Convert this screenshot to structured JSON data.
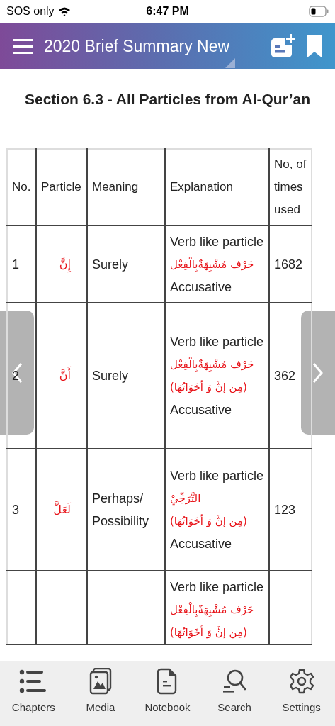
{
  "status_bar": {
    "carrier": "SOS only",
    "time": "6:47 PM"
  },
  "header": {
    "title": "2020 Brief Summary New"
  },
  "section_title": "Section 6.3 - All Particles from Al-Qur’an",
  "table": {
    "columns": [
      "No.",
      "Particle",
      "Meaning",
      "Explanation",
      "No, of times used"
    ],
    "rows": [
      {
        "no": "1",
        "particle": "إِنَّ",
        "meaning": "Surely",
        "explanation": [
          {
            "kind": "text",
            "text": "Verb like particle"
          },
          {
            "kind": "arabic",
            "text": "حَرْف مُشْبِهَةٌبِالْفِعْل"
          },
          {
            "kind": "text",
            "text": "Accusative"
          }
        ],
        "count": "1682"
      },
      {
        "no": "2",
        "particle": "أَنَّ",
        "meaning": "Surely",
        "explanation": [
          {
            "kind": "text",
            "text": "Verb like particle"
          },
          {
            "kind": "arabic",
            "text": "حَرْف مُشْبِهَةٌبِالْفِعْل"
          },
          {
            "kind": "arabic",
            "text": "(مِن إنَّ وَ أخَوَاتُهَا)"
          },
          {
            "kind": "text",
            "text": "Accusative"
          }
        ],
        "count": "362"
      },
      {
        "no": "3",
        "particle": "لَعَلَّ",
        "meaning": "Perhaps/ Possibility",
        "explanation": [
          {
            "kind": "text",
            "text": "Verb like particle"
          },
          {
            "kind": "arabic",
            "text": "التَّرَجِّيْ"
          },
          {
            "kind": "arabic",
            "text": "(مِن إنَّ وَ أخَوَاتُهَا)"
          },
          {
            "kind": "text",
            "text": "Accusative"
          }
        ],
        "count": "123"
      },
      {
        "explanation": [
          {
            "kind": "text",
            "text": "Verb like particle"
          },
          {
            "kind": "arabic",
            "text": "حَرْف مُشْبِهَةٌبِالْفِعْل"
          },
          {
            "kind": "arabic",
            "text": "(مِن إنَّ وَ أخَوَاتُهَا)"
          }
        ]
      }
    ]
  },
  "tabs": [
    {
      "label": "Chapters"
    },
    {
      "label": "Media"
    },
    {
      "label": "Notebook"
    },
    {
      "label": "Search"
    },
    {
      "label": "Settings"
    }
  ]
}
